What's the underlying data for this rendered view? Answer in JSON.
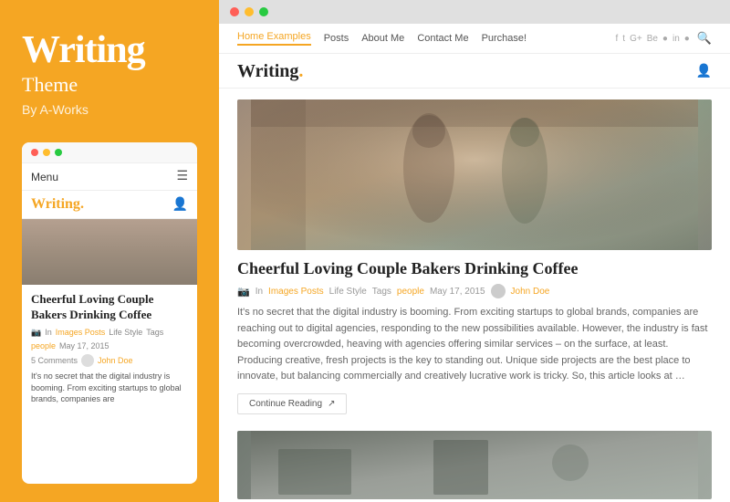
{
  "left": {
    "title": "Writing",
    "subtitle": "Theme",
    "by": "By A-Works"
  },
  "mobile": {
    "dots": [
      "red",
      "yellow",
      "green"
    ],
    "nav_menu": "Menu",
    "brand": "Writing",
    "brand_dot": ".",
    "article_title": "Cheerful Loving Couple Bakers Drinking Coffee",
    "meta_in": "In",
    "meta_category1": "Images Posts",
    "meta_category2": "Life Style",
    "meta_tags": "Tags",
    "meta_tag1": "people",
    "meta_date": "May 17, 2015",
    "meta_comments": "5 Comments",
    "meta_author": "John Doe",
    "excerpt": "It's no secret that the digital industry is booming. From exciting startups to global brands, companies are"
  },
  "desktop": {
    "browser_dots": [
      "red",
      "yellow",
      "green"
    ],
    "nav_links": [
      "Home Examples",
      "Posts",
      "About Me",
      "Contact Me",
      "Purchase!"
    ],
    "nav_active": "Home Examples",
    "social_icons": [
      "f",
      "t",
      "G+",
      "Be",
      "●",
      "in",
      "●"
    ],
    "brand": "Writing",
    "brand_dot": ".",
    "hero_article": {
      "title": "Cheerful Loving Couple Bakers Drinking Coffee",
      "meta_in": "In",
      "meta_category1": "Images Posts",
      "meta_category2": "Life Style",
      "meta_tags": "Tags",
      "meta_tag1": "people",
      "meta_date": "May 17, 2015",
      "meta_author": "John Doe",
      "excerpt": "It's no secret that the digital industry is booming. From exciting startups to global brands, companies are reaching out to digital agencies, responding to the new possibilities available. However, the industry is fast becoming overcrowded, heaving with agencies offering similar services – on the surface, at least. Producing creative, fresh projects is the key to standing out. Unique side projects are the best place to innovate, but balancing commercially and creatively lucrative work is tricky. So, this article looks at …",
      "continue_btn": "Continue Reading"
    }
  }
}
